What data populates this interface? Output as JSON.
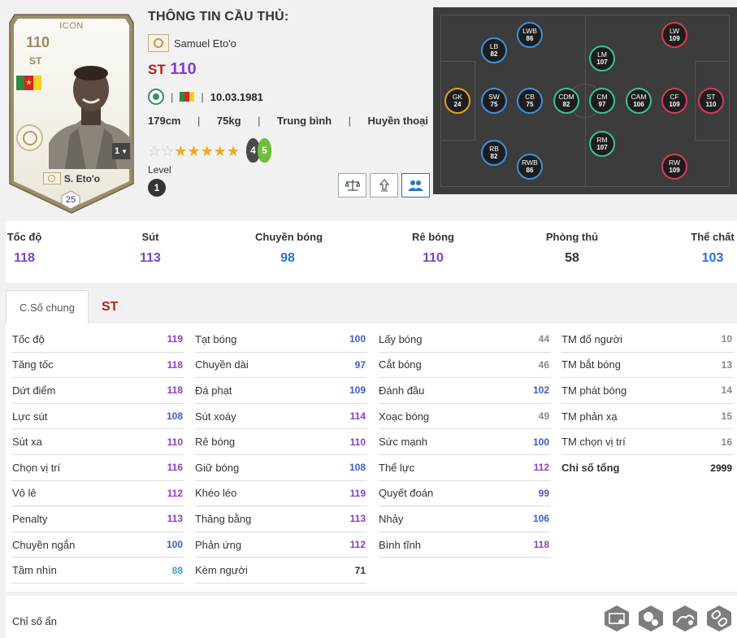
{
  "card": {
    "tier": "ICON",
    "overall": "110",
    "position": "ST",
    "level_select": "1",
    "name": "S. Eto'o",
    "number": "25"
  },
  "info": {
    "heading": "THÔNG TIN CẦU THỦ:",
    "full_name": "Samuel Eto'o",
    "main_position": "ST",
    "main_ovr": "110",
    "birthdate": "10.03.1981",
    "height": "179cm",
    "weight": "75kg",
    "body_type": "Trung bình",
    "reputation": "Huyền thoại",
    "separator": "|",
    "skill_stars_filled": 5,
    "skill_stars_total": 7,
    "weak_foot_left": "4",
    "weak_foot_right": "5",
    "level_label": "Level",
    "level_value": "1"
  },
  "actions": [
    {
      "icon": "compare-scale-icon"
    },
    {
      "icon": "upgrade-arrow-icon"
    },
    {
      "icon": "team-chemistry-icon"
    }
  ],
  "pitch_positions": [
    {
      "pos": "GK",
      "ovr": "24",
      "group": "gk"
    },
    {
      "pos": "LB",
      "ovr": "82",
      "group": "def"
    },
    {
      "pos": "SW",
      "ovr": "75",
      "group": "def"
    },
    {
      "pos": "RB",
      "ovr": "82",
      "group": "def"
    },
    {
      "pos": "LWB",
      "ovr": "86",
      "group": "def"
    },
    {
      "pos": "CB",
      "ovr": "75",
      "group": "def"
    },
    {
      "pos": "RWB",
      "ovr": "86",
      "group": "def"
    },
    {
      "pos": "CDM",
      "ovr": "82",
      "group": "mid"
    },
    {
      "pos": "LM",
      "ovr": "107",
      "group": "mid"
    },
    {
      "pos": "CM",
      "ovr": "97",
      "group": "mid"
    },
    {
      "pos": "RM",
      "ovr": "107",
      "group": "mid"
    },
    {
      "pos": "CAM",
      "ovr": "106",
      "group": "mid"
    },
    {
      "pos": "LW",
      "ovr": "109",
      "group": "att"
    },
    {
      "pos": "CF",
      "ovr": "109",
      "group": "att"
    },
    {
      "pos": "RW",
      "ovr": "109",
      "group": "att"
    },
    {
      "pos": "ST",
      "ovr": "110",
      "group": "att"
    }
  ],
  "summary": [
    {
      "label": "Tốc độ",
      "value": "118",
      "color": "#7b3fd6"
    },
    {
      "label": "Sút",
      "value": "113",
      "color": "#7b3fd6"
    },
    {
      "label": "Chuyền bóng",
      "value": "98",
      "color": "#2a6fd0"
    },
    {
      "label": "Rê bóng",
      "value": "110",
      "color": "#7b3fd6"
    },
    {
      "label": "Phòng thủ",
      "value": "58",
      "color": "#333333"
    },
    {
      "label": "Thể chất",
      "value": "103",
      "color": "#2a6fd0"
    }
  ],
  "tabs": [
    {
      "label": "C.Số chung"
    },
    {
      "label": "ST"
    }
  ],
  "stats_columns": [
    [
      {
        "label": "Tốc độ",
        "value": "119",
        "color": "#8b3bd1"
      },
      {
        "label": "Tăng tốc",
        "value": "118",
        "color": "#8b3bd1"
      },
      {
        "label": "Dứt điểm",
        "value": "118",
        "color": "#8b3bd1"
      },
      {
        "label": "Lực sút",
        "value": "108",
        "color": "#3b5bd1"
      },
      {
        "label": "Sút xa",
        "value": "110",
        "color": "#8b3bd1"
      },
      {
        "label": "Chọn vị trí",
        "value": "116",
        "color": "#8b3bd1"
      },
      {
        "label": "Vô lê",
        "value": "112",
        "color": "#8b3bd1"
      },
      {
        "label": "Penalty",
        "value": "113",
        "color": "#8b3bd1"
      },
      {
        "label": "Chuyền ngắn",
        "value": "100",
        "color": "#3b5bd1"
      },
      {
        "label": "Tầm nhìn",
        "value": "88",
        "color": "#3aa0d8"
      }
    ],
    [
      {
        "label": "Tạt bóng",
        "value": "100",
        "color": "#3b5bd1"
      },
      {
        "label": "Chuyền dài",
        "value": "97",
        "color": "#3b5bd1"
      },
      {
        "label": "Đá phạt",
        "value": "109",
        "color": "#3b5bd1"
      },
      {
        "label": "Sút xoáy",
        "value": "114",
        "color": "#8b3bd1"
      },
      {
        "label": "Rê bóng",
        "value": "110",
        "color": "#8b3bd1"
      },
      {
        "label": "Giữ bóng",
        "value": "108",
        "color": "#3b5bd1"
      },
      {
        "label": "Khéo léo",
        "value": "119",
        "color": "#8b3bd1"
      },
      {
        "label": "Thăng bằng",
        "value": "113",
        "color": "#8b3bd1"
      },
      {
        "label": "Phản ứng",
        "value": "112",
        "color": "#8b3bd1"
      },
      {
        "label": "Kèm người",
        "value": "71",
        "color": "#333333"
      }
    ],
    [
      {
        "label": "Lấy bóng",
        "value": "44",
        "color": "#888888"
      },
      {
        "label": "Cắt bóng",
        "value": "46",
        "color": "#888888"
      },
      {
        "label": "Đánh đầu",
        "value": "102",
        "color": "#3b5bd1"
      },
      {
        "label": "Xoạc bóng",
        "value": "49",
        "color": "#888888"
      },
      {
        "label": "Sức mạnh",
        "value": "100",
        "color": "#3b5bd1"
      },
      {
        "label": "Thể lực",
        "value": "112",
        "color": "#8b3bd1"
      },
      {
        "label": "Quyết đoán",
        "value": "99",
        "color": "#3b5bd1"
      },
      {
        "label": "Nhảy",
        "value": "106",
        "color": "#3b5bd1"
      },
      {
        "label": "Bình tĩnh",
        "value": "118",
        "color": "#8b3bd1"
      }
    ],
    [
      {
        "label": "TM đổ người",
        "value": "10",
        "color": "#888888"
      },
      {
        "label": "TM bắt bóng",
        "value": "13",
        "color": "#888888"
      },
      {
        "label": "TM phát bóng",
        "value": "14",
        "color": "#888888"
      },
      {
        "label": "TM phản xạ",
        "value": "15",
        "color": "#888888"
      },
      {
        "label": "TM chọn vị trí",
        "value": "16",
        "color": "#888888"
      },
      {
        "label": "Chỉ số tổng",
        "value": "2999",
        "color": "#222222",
        "total": true
      }
    ]
  ],
  "hidden": {
    "label": "Chỉ số ẩn",
    "traits": [
      {
        "icon": "finesse-shot-trait-icon"
      },
      {
        "icon": "flair-trait-icon"
      },
      {
        "icon": "speed-dribbler-trait-icon"
      },
      {
        "icon": "chain-trait-icon"
      }
    ]
  }
}
